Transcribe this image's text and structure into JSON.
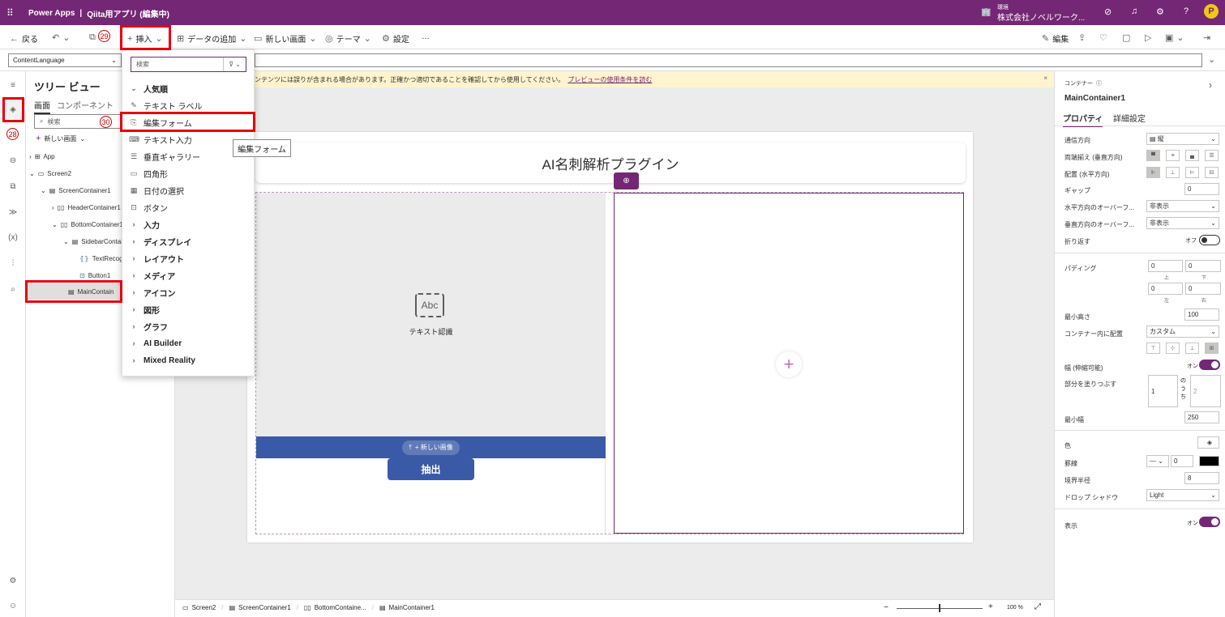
{
  "topbar": {
    "app_name": "Power Apps",
    "separator": "|",
    "title": "Qiita用アプリ (編集中)",
    "env_label": "環境",
    "env_name": "株式会社ノベルワーク..."
  },
  "cmdbar": {
    "back": "戻る",
    "insert": "挿入",
    "add_data": "データの追加",
    "new_screen": "新しい画面",
    "theme": "テーマ",
    "settings": "設定",
    "more": "…",
    "edit": "編集"
  },
  "formula": {
    "property": "ContentLanguage"
  },
  "tree": {
    "title": "ツリー ビュー",
    "tab_screens": "画面",
    "tab_components": "コンポーネント",
    "search_placeholder": "検索",
    "new_screen": "新しい画面",
    "nodes": [
      "App",
      "Screen2",
      "ScreenContainer1",
      "HeaderContainer1",
      "BottomContainer1",
      "SidebarContai",
      "TextRecog",
      "Button1",
      "MainContain"
    ]
  },
  "menu": {
    "search_placeholder": "検索",
    "items": [
      "人気順",
      "テキスト ラベル",
      "編集フォーム",
      "テキスト入力",
      "垂直ギャラリー",
      "四角形",
      "日付の選択",
      "ボタン",
      "入力",
      "ディスプレイ",
      "レイアウト",
      "メディア",
      "アイコン",
      "図形",
      "グラフ",
      "AI Builder",
      "Mixed Reality"
    ],
    "tooltip": "編集フォーム"
  },
  "banner": {
    "text": "ンテンツには誤りが含まれる場合があります。正確かつ適切であることを確認してから使用してください。",
    "link": "プレビューの使用条件を読む"
  },
  "canvas": {
    "header_title": "AI名刺解析プラグイン",
    "abc": "Abc",
    "text_recog": "テキスト認識",
    "new_image": "+ 新しい画像",
    "extract": "抽出"
  },
  "status": {
    "crumbs": [
      "Screen2",
      "ScreenContainer1",
      "BottomContaine...",
      "MainContainer1"
    ],
    "zoom": "100 %",
    "minus": "−",
    "plus": "+"
  },
  "props": {
    "kind": "コンテナー",
    "name": "MainContainer1",
    "tab_props": "プロパティ",
    "tab_adv": "詳細設定",
    "rows": {
      "direction": "通信方向",
      "justify": "両端揃え (垂直方向)",
      "align": "配置 (水平方向)",
      "gap": "ギャップ",
      "hover_h": "水平方向のオーバーフ...",
      "hover_v": "垂直方向のオーバーフ...",
      "wrap": "折り返す",
      "padding": "パディング",
      "min_height": "最小高さ",
      "align_in": "コンテナー内に配置",
      "flex_width": "幅 (伸縮可能)",
      "fill": "部分を塗りつぶす",
      "min_width": "最小幅",
      "color": "色",
      "border": "罫線",
      "radius": "境界半径",
      "shadow": "ドロップ シャドウ",
      "visible": "表示"
    },
    "values": {
      "direction": "縦",
      "gap": "0",
      "hover_h": "非表示",
      "hover_v": "非表示",
      "wrap": "オフ",
      "pad_top": "0",
      "pad_bottom": "0",
      "pad_left": "0",
      "pad_right": "0",
      "pad_lbl_top": "上",
      "pad_lbl_bottom": "下",
      "pad_lbl_left": "左",
      "pad_lbl_right": "右",
      "min_height": "100",
      "align_in": "カスタム",
      "flex_width": "オン",
      "fill": "1",
      "fill_mid": "の う ち",
      "fill_of": "2",
      "min_width": "250",
      "border_w": "0",
      "radius": "8",
      "shadow": "Light",
      "visible": "オン"
    }
  },
  "annotations": {
    "n28": "28",
    "n29": "29",
    "n30": "30"
  },
  "colors": {
    "brand": "#742774",
    "blue_bar": "#3a5aa8",
    "button": "#3a5aa8"
  }
}
